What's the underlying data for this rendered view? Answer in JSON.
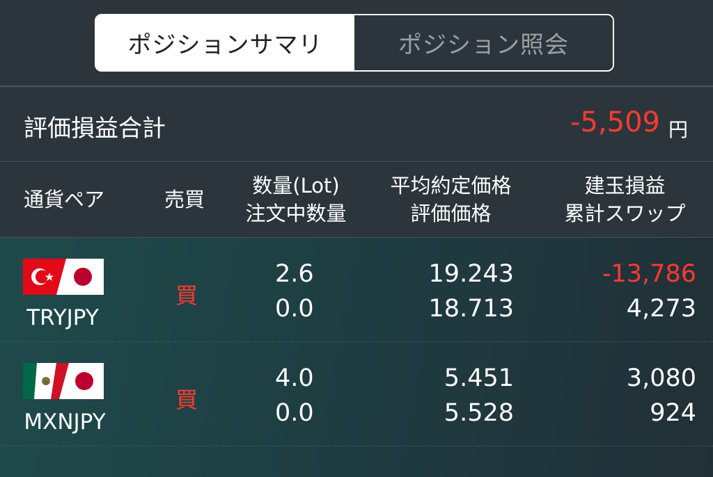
{
  "tabs": {
    "summary_label": "ポジションサマリ",
    "inquiry_label": "ポジション照会"
  },
  "summary": {
    "label": "評価損益合計",
    "value": "-5,509",
    "unit": "円"
  },
  "columns": {
    "pair": "通貨ペア",
    "side": "売買",
    "qty_line1": "数量(Lot)",
    "qty_line2": "注文中数量",
    "price_line1": "平均約定価格",
    "price_line2": "評価価格",
    "pnl_line1": "建玉損益",
    "pnl_line2": "累計スワップ"
  },
  "positions": [
    {
      "pair": "TRYJPY",
      "side": "買",
      "quantity": "2.6",
      "pending_quantity": "0.0",
      "avg_price": "19.243",
      "eval_price": "18.713",
      "pnl": "-13,786",
      "swap": "4,273",
      "flag_icon": "turkey-japan-flag-icon"
    },
    {
      "pair": "MXNJPY",
      "side": "買",
      "quantity": "4.0",
      "pending_quantity": "0.0",
      "avg_price": "5.451",
      "eval_price": "5.528",
      "pnl": "3,080",
      "swap": "924",
      "flag_icon": "mexico-japan-flag-icon"
    }
  ],
  "colors": {
    "loss": "#ff3b30",
    "background": "#2b353b",
    "accent_active_tab": "#ffffff"
  }
}
